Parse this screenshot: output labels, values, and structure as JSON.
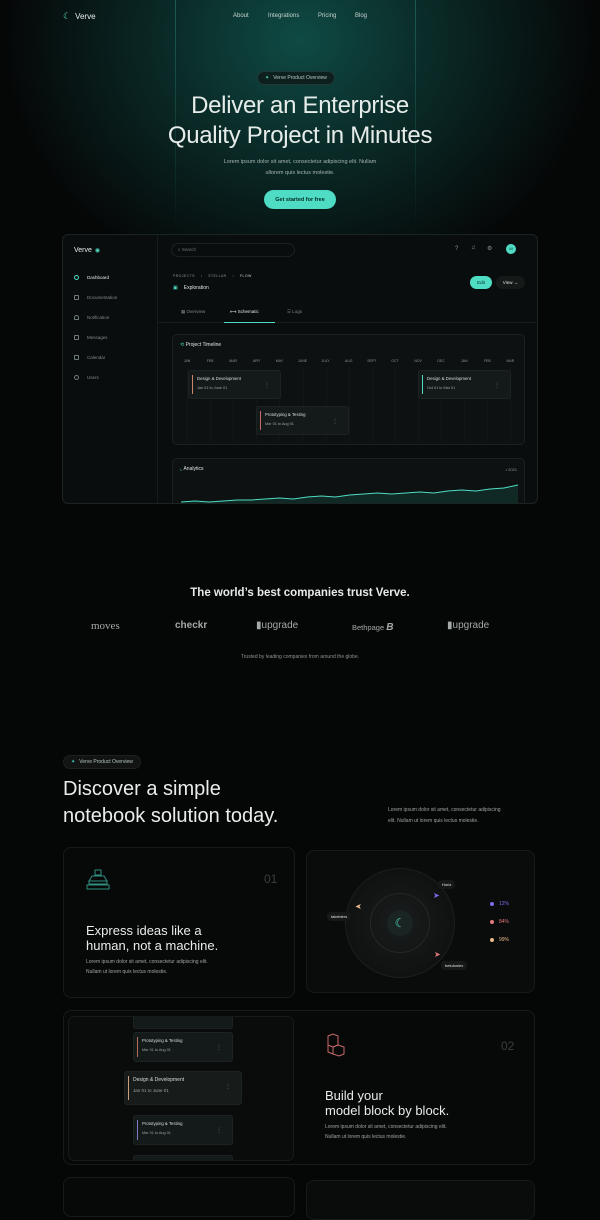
{
  "nav": {
    "brand": "Verve",
    "links": [
      "About",
      "Integrations",
      "Pricing",
      "Blog"
    ]
  },
  "hero": {
    "badge": "Verve Product Overview",
    "title_line1": "Deliver an Enterprise",
    "title_line2": "Quality Project in Minutes",
    "subtitle_line1": "Lorem ipsum dolor sit amet, consectetur adipiscing elit. Nullam",
    "subtitle_line2": "ullorem quis lectus molestie.",
    "cta": "Get started for free"
  },
  "dashboard": {
    "brand": "Verve",
    "search_placeholder": "Search",
    "avatar": "M",
    "sidebar": [
      "Dashboard",
      "Documentation",
      "Notification",
      "Messages",
      "Calendar",
      "Users"
    ],
    "breadcrumb": [
      "PROJECTS",
      "STELLAR",
      "FLOW"
    ],
    "page_title": "Exploration",
    "edit": "Edit",
    "view": "View →",
    "tabs": [
      "Overview",
      "Schematic",
      "Logs"
    ],
    "timeline": {
      "title": "Project Timeline",
      "months": [
        "JAN",
        "FEB",
        "MAR",
        "APR",
        "MAY",
        "JUNE",
        "JULY",
        "AUG",
        "SEPT",
        "OCT",
        "NOV",
        "DEC",
        "JAN",
        "FEB",
        "MAR"
      ],
      "tasks": [
        {
          "title": "Design & Development",
          "dates": "Jan 01 to June 01",
          "color": "#c9846a"
        },
        {
          "title": "Prototyping & Testing",
          "dates": "Mar 01 to Aug 01",
          "color": "#c96a6a"
        },
        {
          "title": "Design & Development",
          "dates": "Oct 01 to Mar 01",
          "color": "#4fdcc4"
        }
      ]
    },
    "analytics": {
      "title": "Analytics",
      "year": "2021",
      "series": [
        4,
        5,
        4,
        5,
        6,
        6,
        7,
        8,
        7,
        9,
        10,
        9,
        11,
        12,
        13,
        12,
        13,
        14,
        13,
        15,
        16,
        15,
        17,
        18,
        21
      ]
    }
  },
  "trust": {
    "title": "The world’s best companies trust Verve.",
    "logos": [
      "moves",
      "checkr",
      "upgrade",
      "Bethpage",
      "upgrade"
    ],
    "caption": "Trusted by leading companies from around the globe."
  },
  "features": {
    "badge": "Verve Product Overview",
    "title_line1": "Discover a simple",
    "title_line2": "notebook solution today.",
    "desc_line1": "Lorem ipsum dolor sit amet, consectetur adipiscing",
    "desc_line2": "elit. Nullam ut lorem quis lectus molestie.",
    "f1": {
      "num": "01",
      "title_line1": "Express ideas like a",
      "title_line2": "human, not a machine.",
      "desc_line1": "Lorem ipsum dolor sit amet, consectetur adipiscing elit.",
      "desc_line2": "Nullam ut lorem quis lectus molestie.",
      "orbit": {
        "tags": [
          "Horiz",
          "takeblers",
          "betuloniex"
        ],
        "legend": [
          {
            "label": "12%",
            "color": "#7b6cf0"
          },
          {
            "label": "84%",
            "color": "#e07a7a"
          },
          {
            "label": "99%",
            "color": "#e8b98a"
          }
        ]
      }
    },
    "f2": {
      "num": "02",
      "title_line1": "Build your",
      "title_line2": "model block by block.",
      "desc_line1": "Lorem ipsum dolor sit amet, consectetur adipiscing elit.",
      "desc_line2": "Nullam ut lorem quis lectus molestie.",
      "tasks": [
        {
          "title": "Prototyping & Testing",
          "dates": "Mar 01 to Aug 01",
          "color": "#b86a5a"
        },
        {
          "title": "Design & Development",
          "dates": "Jan 01 to June 01",
          "color": "#c9a07a"
        },
        {
          "title": "Prototyping & Testing",
          "dates": "Mar 01 to Aug 01",
          "color": "#7a7ac9"
        }
      ]
    }
  },
  "colors": {
    "accent": "#4fdcc4",
    "bg": "#050606"
  }
}
